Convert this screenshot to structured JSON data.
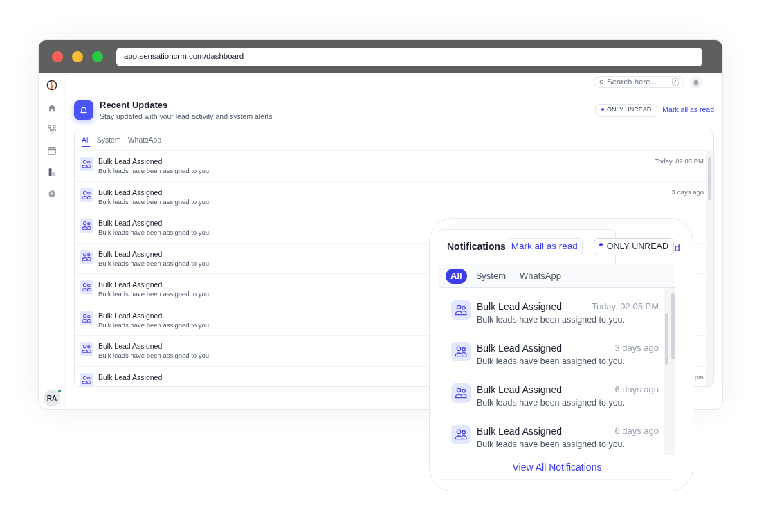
{
  "browser": {
    "url": "app.sensationcrm.com/dashboard"
  },
  "sidebar": {
    "avatar": {
      "initials": "RA",
      "online": true
    }
  },
  "topbar": {
    "search": {
      "placeholder": "Search here...",
      "shortcut": "/"
    }
  },
  "updates": {
    "title": "Recent Updates",
    "subtitle": "Stay updated with your lead activity and system alerts",
    "filter_label": "ONLY UNREAD",
    "mark_all_label": "Mark all as read",
    "tabs": [
      {
        "label": "All",
        "selected": true
      },
      {
        "label": "System",
        "selected": false
      },
      {
        "label": "WhatsApp",
        "selected": false
      }
    ],
    "rows": [
      {
        "title": "Bulk Lead Assigned",
        "description": "Bulk leads have been assigned to you.",
        "time": "Today, 02:05 PM"
      },
      {
        "title": "Bulk Lead Assigned",
        "description": "Bulk leads have been assigned to you.",
        "time": "3 days ago"
      },
      {
        "title": "Bulk Lead Assigned",
        "description": "Bulk leads have been assigned to you."
      },
      {
        "title": "Bulk Lead Assigned",
        "description": "Bulk leads have been assigned to you."
      },
      {
        "title": "Bulk Lead Assigned",
        "description": "Bulk leads have been assigned to you."
      },
      {
        "title": "Bulk Lead Assigned",
        "description": "Bulk leads have been assigned to you"
      },
      {
        "title": "Bulk Lead Assigned",
        "description": "Bulk leads have been assigned to you."
      },
      {
        "title": "Bulk Lead Assigned",
        "time": "pm"
      }
    ]
  },
  "notifications_popup": {
    "title": "Notifications",
    "mark_all_label": "Mark all as read",
    "filter_label": "ONLY UNREAD",
    "label_fragment": "d",
    "tabs": [
      {
        "label": "All",
        "selected": true
      },
      {
        "label": "System",
        "selected": false
      },
      {
        "label": "WhatsApp",
        "selected": false
      }
    ],
    "rows": [
      {
        "title": "Bulk Lead Assigned",
        "description": "Bulk leads have been assigned to you.",
        "time": "Today, 02:05 PM"
      },
      {
        "title": "Bulk Lead Assigned",
        "description": "Bulk leads have been assigned to you.",
        "time": "3 days ago"
      },
      {
        "title": "Bulk Lead Assigned",
        "description": "Bulk leads have been assigned to you.",
        "time": "6 days ago"
      },
      {
        "title": "Bulk Lead Assigned",
        "description": "Bulk leads have been assigned to you.",
        "time": "6 days ago"
      }
    ],
    "footer_link": "View All Notifications"
  }
}
